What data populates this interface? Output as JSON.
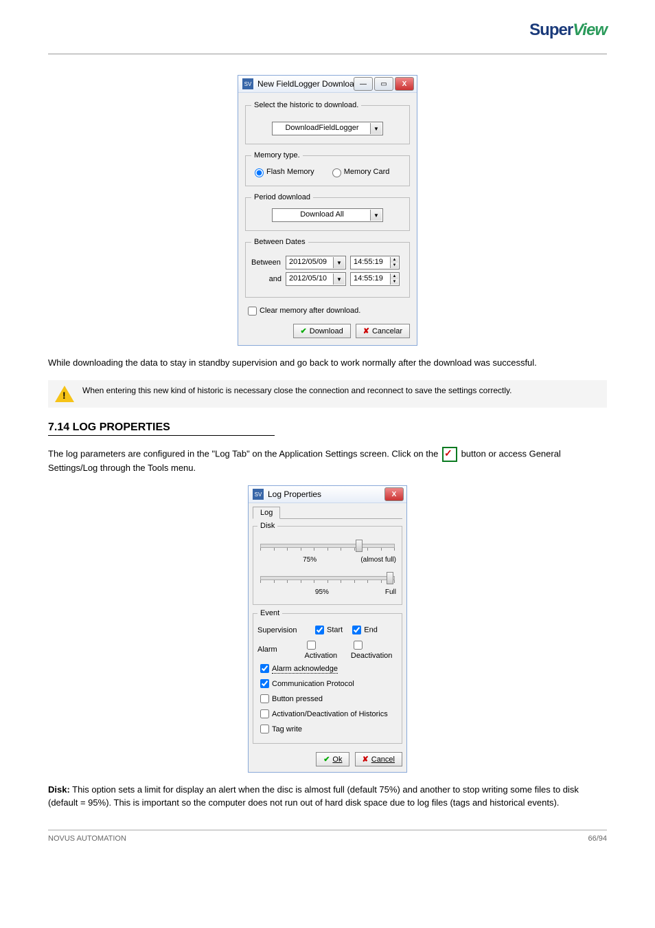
{
  "logo": {
    "text1": "Super",
    "text2": "View"
  },
  "dialog1": {
    "title": "New FieldLogger Download",
    "select_historic_legend": "Select the historic to download.",
    "historic_value": "DownloadFieldLogger",
    "memory_type_legend": "Memory type.",
    "radio_flash": "Flash Memory",
    "radio_card": "Memory Card",
    "period_legend": "Period download",
    "period_value": "Download All",
    "between_legend": "Between Dates",
    "between_label": "Between",
    "and_label": "and",
    "date1": "2012/05/09",
    "time1": "14:55:19",
    "date2": "2012/05/10",
    "time2": "14:55:19",
    "clear_label": "Clear memory after download.",
    "btn_download": "Download",
    "btn_cancel": "Cancelar"
  },
  "para1": "While downloading the data to stay in standby supervision and go back to work normally after the download was successful.",
  "warn_text": "When entering this new kind of historic is necessary close the connection and reconnect to save the settings correctly.",
  "section_title": "7.14 LOG PROPERTIES",
  "para2_a": "The log parameters are configured in the \"Log Tab\" on the Application Settings screen. Click on the ",
  "para2_b": " button or access General Settings/Log through the Tools menu.",
  "dialog2": {
    "title": "Log Properties",
    "tab": "Log",
    "disk_legend": "Disk",
    "slider1_left": "75%",
    "slider1_right": "(almost full)",
    "slider2_left": "95%",
    "slider2_right": "Full",
    "event_legend": "Event",
    "supervision_label": "Supervision",
    "start_label": "Start",
    "end_label": "End",
    "alarm_label": "Alarm",
    "activation_label": "Activation",
    "deactivation_label": "Deactivation",
    "alarm_ack": "Alarm acknowledge",
    "comm_proto": "Communication Protocol",
    "button_pressed": "Button pressed",
    "act_deact_hist": "Activation/Deactivation of Historics",
    "tag_write": "Tag write",
    "btn_ok": "Ok",
    "btn_cancel": "Cancel"
  },
  "para3_title": "Disk:",
  "para3_body": " This option sets a limit for display an alert when the disc is almost full (default 75%) and another to stop writing some files to disk (default = 95%). This is important so the computer does not run out of hard disk space due to log files (tags and historical events).",
  "footer": {
    "left": "NOVUS AUTOMATION",
    "right": "66/94"
  }
}
